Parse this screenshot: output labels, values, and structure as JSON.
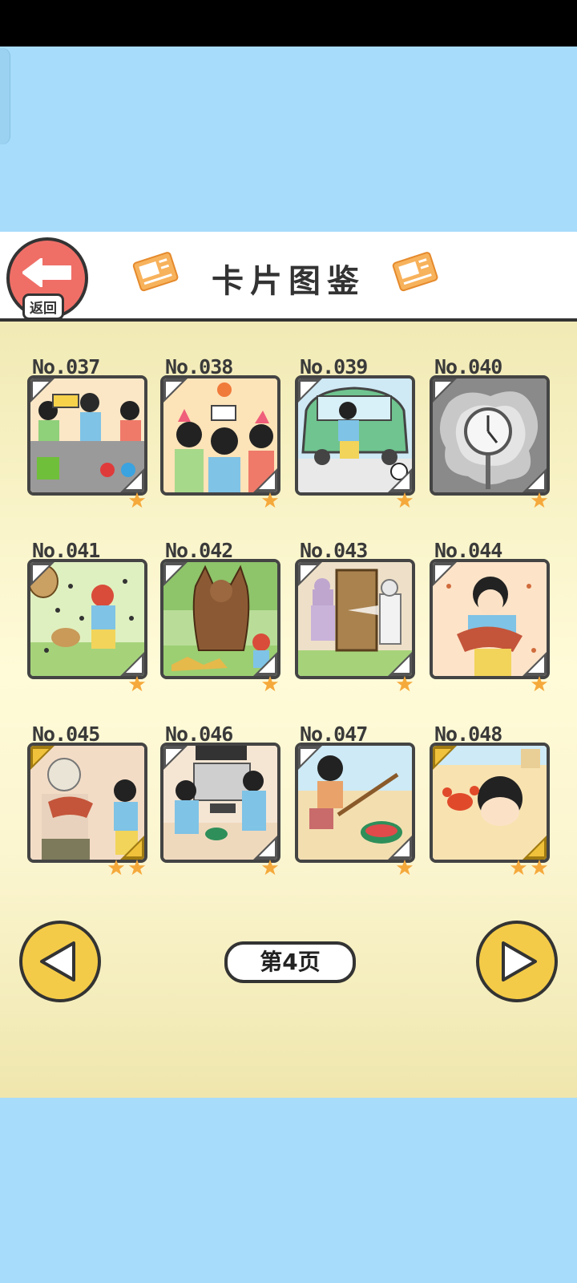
{
  "header": {
    "title": "卡片图鉴",
    "back_label": "返回"
  },
  "cards": [
    {
      "number": "No.037",
      "stars": 1,
      "scene": "birthday-party"
    },
    {
      "number": "No.038",
      "stars": 1,
      "scene": "party-hats"
    },
    {
      "number": "No.039",
      "stars": 1,
      "scene": "car-soccer"
    },
    {
      "number": "No.040",
      "stars": 1,
      "scene": "clock-grey"
    },
    {
      "number": "No.041",
      "stars": 1,
      "scene": "bees"
    },
    {
      "number": "No.042",
      "stars": 1,
      "scene": "bear-forest"
    },
    {
      "number": "No.043",
      "stars": 1,
      "scene": "spray-door"
    },
    {
      "number": "No.044",
      "stars": 1,
      "scene": "shirt-food"
    },
    {
      "number": "No.045",
      "stars": 2,
      "scene": "old-man"
    },
    {
      "number": "No.046",
      "stars": 1,
      "scene": "tv-game"
    },
    {
      "number": "No.047",
      "stars": 1,
      "scene": "beach-watermelon"
    },
    {
      "number": "No.048",
      "stars": 2,
      "scene": "crab-sand"
    }
  ],
  "pagination": {
    "current_page_label": "第4页"
  },
  "colors": {
    "sky": "#a7dcfb",
    "panel": "#fffbd8",
    "back_button": "#ef6f67",
    "nav_button": "#f4cb48",
    "star": "#f5a93b"
  },
  "icons": {
    "back": "left-arrow-icon",
    "prev": "triangle-left-icon",
    "next": "triangle-right-icon",
    "star": "star-icon"
  }
}
